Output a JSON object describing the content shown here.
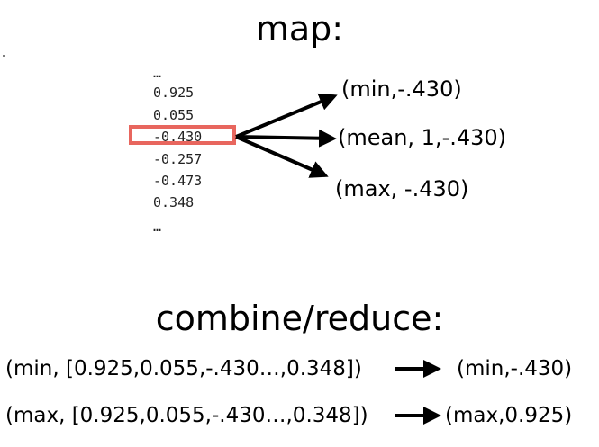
{
  "map_title": "map:",
  "values": [
    "…",
    "0.925",
    "0.055",
    "-0.430",
    "-0.257",
    "-0.473",
    "0.348",
    "…"
  ],
  "highlight_color": "#e8665e",
  "map_outputs": [
    "(min,-.430)",
    "(mean, 1,-.430)",
    "(max, -.430)"
  ],
  "reduce_title": "combine/reduce:",
  "reduce_rows": [
    {
      "input": "(min, [0.925,0.055,-.430…,0.348])",
      "output": "(min,-.430)"
    },
    {
      "input": "(max, [0.925,0.055,-.430…,0.348])",
      "output": "(max,0.925)"
    }
  ]
}
